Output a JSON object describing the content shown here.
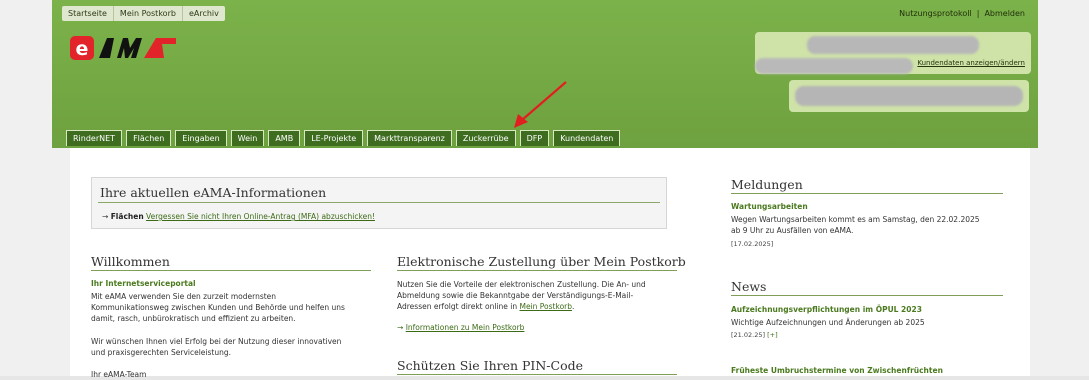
{
  "top_nav": [
    "Startseite",
    "Mein Postkorb",
    "eArchiv"
  ],
  "top_links": {
    "protocol": "Nutzungsprotokoll",
    "separator": "|",
    "logout": "Abmelden"
  },
  "logo": {
    "text": "eAMA"
  },
  "user_box": {
    "customer_link": "Kundendaten anzeigen/ändern"
  },
  "tabs": [
    "RinderNET",
    "Flächen",
    "Eingaben",
    "Wein",
    "AMB",
    "LE-Projekte",
    "Markttransparenz",
    "Zuckerrübe",
    "DFP",
    "Kundendaten"
  ],
  "info": {
    "title": "Ihre aktuellen eAMA-Informationen",
    "arrow": "→",
    "label": "Flächen",
    "link": "Vergessen Sie nicht Ihren Online-Antrag (MFA) abzuschicken!"
  },
  "welcome": {
    "title": "Willkommen",
    "subtitle": "Ihr Internetserviceportal",
    "p1_l1": "Mit eAMA verwenden Sie den zurzeit modernsten",
    "p1_l2": "Kommunikationsweg zwischen Kunden und Behörde und helfen uns",
    "p1_l3": "damit, rasch, unbürokratisch und effizient zu arbeiten.",
    "p2_l1": "Wir wünschen Ihnen viel Erfolg bei der Nutzung dieser innovativen",
    "p2_l2": "und praxisgerechten Serviceleistung.",
    "signoff": "Ihr eAMA-Team"
  },
  "delivery": {
    "title": "Elektronische Zustellung über Mein Postkorb",
    "l1": "Nutzen Sie die Vorteile der elektronischen Zustellung. Die An- und",
    "l2": "Abmeldung sowie die Bekanntgabe der Verständigungs-E-Mail-",
    "l3_pre": "Adressen erfolgt direkt online in",
    "l3_link": "Mein Postkorb",
    "l3_post": ".",
    "arrow": "→",
    "info_link": "Informationen zu Mein Postkorb"
  },
  "pin": {
    "title": "Schützen Sie Ihren PIN-Code"
  },
  "messages": {
    "title": "Meldungen",
    "subtitle": "Wartungsarbeiten",
    "l1": "Wegen Wartungsarbeiten kommt es am Samstag, den 22.02.2025",
    "l2": "ab 9 Uhr zu Ausfällen von eAMA.",
    "date": "[17.02.2025]"
  },
  "news": {
    "title": "News",
    "item1_title": "Aufzeichnungsverpflichtungen im ÖPUL 2023",
    "item1_text": "Wichtige Aufzeichnungen und Änderungen ab 2025",
    "item1_date": "[21.02.25]",
    "item1_more": "[+]",
    "item2_title": "Früheste Umbruchstermine von Zwischenfrüchten"
  },
  "colors": {
    "header_green": "#75ab44",
    "tab_green": "#3e6d1f",
    "link_green": "#3c6b16",
    "arrow_red": "#e02020"
  }
}
